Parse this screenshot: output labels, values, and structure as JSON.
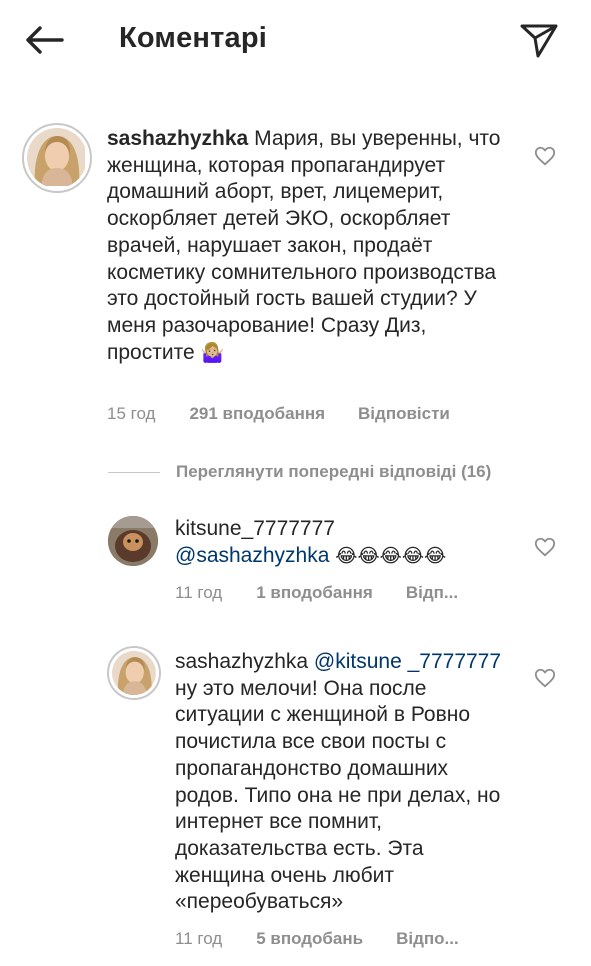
{
  "header": {
    "title": "Коментарі",
    "back_icon": "arrow-left-icon",
    "send_icon": "paper-plane-icon"
  },
  "comments": [
    {
      "username": "sashazhyzhka",
      "text": "Мария, вы уверенны, что женщина, которая пропагандирует домашний аборт, врет, лицемерит, оскорбляет детей ЭКО, оскорбляет врачей, нарушает закон, продаёт косметику сомнительного производства это достойный гость вашей студии? У меня разочарование! Сразу Диз, простите",
      "emoji": "🤷🏼‍♀️",
      "time": "15 год",
      "likes": "291 вподобання",
      "reply": "Відповісти"
    }
  ],
  "view_replies": "Переглянути попередні відповіді (16)",
  "replies": [
    {
      "username": "kitsune_7777777",
      "mention": "@sashazhyzhka",
      "emoji": "😂😂😂😂😂",
      "time": "11 год",
      "likes": "1 вподобання",
      "reply": "Відп..."
    },
    {
      "username": "sashazhyzhka",
      "mention": "@kitsune _7777777",
      "text": "ну это мелочи! Она после ситуации с женщиной в Ровно почистила все свои посты с пропагандонство домашних родов. Типо она не при делах, но интернет все помнит, доказательства есть. Эта женщина очень любит «переобуваться»",
      "time": "11 год",
      "likes": "5 вподобань",
      "reply": "Відпо..."
    }
  ],
  "colors": {
    "text": "#262626",
    "secondary": "#8e8e8e",
    "mention": "#00376b"
  }
}
